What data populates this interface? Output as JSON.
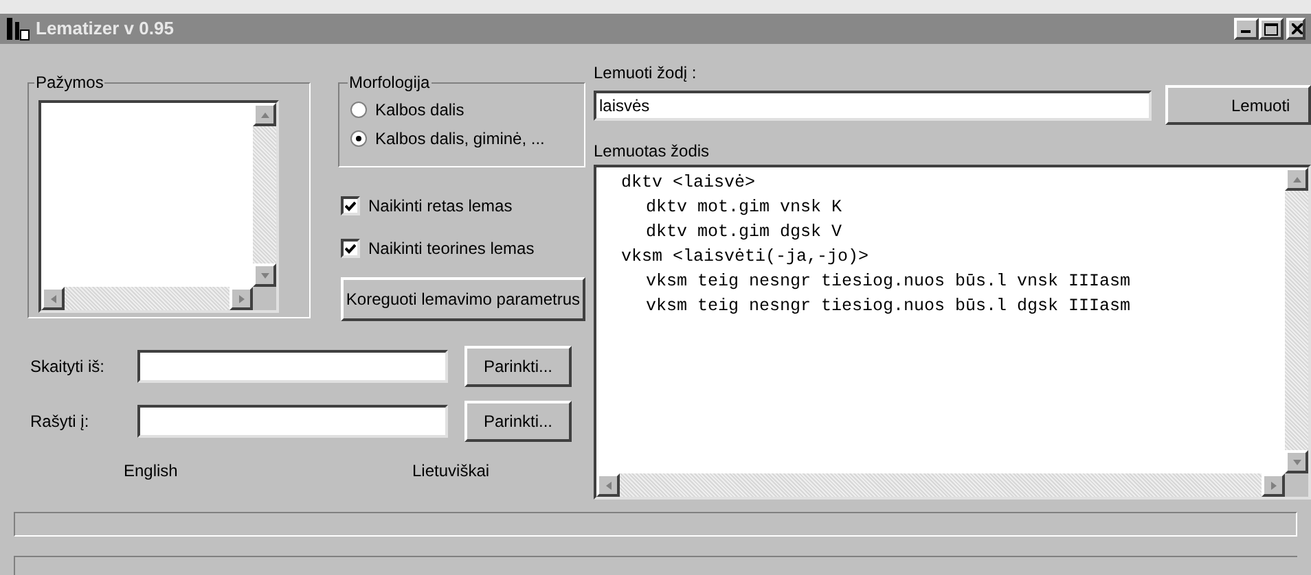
{
  "window": {
    "title": "Lematizer v 0.95"
  },
  "notes_group": {
    "title": "Pažymos"
  },
  "morphology": {
    "title": "Morfologija",
    "options": [
      {
        "label": "Kalbos dalis",
        "selected": false
      },
      {
        "label": "Kalbos dalis, giminė, ...",
        "selected": true
      }
    ]
  },
  "checkboxes": [
    {
      "label": "Naikinti retas lemas",
      "checked": true
    },
    {
      "label": "Naikinti teorines lemas",
      "checked": true
    }
  ],
  "adjust_button": "Koreguoti lemavimo parametrus",
  "files": [
    {
      "label": "Skaityti iš:",
      "button": "Parinkti..."
    },
    {
      "label": "Rašyti į:",
      "button": "Parinkti..."
    }
  ],
  "languages": [
    "English",
    "Lietuviškai"
  ],
  "word": {
    "label": "Lemuoti žodį :",
    "value": "laisvės",
    "button": "Lemuoti"
  },
  "result": {
    "label": "Lemuotas žodis",
    "lines": [
      {
        "text": "dktv <laisvė>",
        "children": [
          {
            "text": "dktv mot.gim vnsk K"
          },
          {
            "text": "dktv mot.gim dgsk V"
          }
        ]
      },
      {
        "text": "vksm <laisvėti(-ja,-jo)>",
        "children": [
          {
            "text": "vksm teig nesngr tiesiog.nuos būs.l vnsk IIIasm"
          },
          {
            "text": "vksm teig nesngr tiesiog.nuos būs.l dgsk IIIasm"
          }
        ]
      }
    ]
  }
}
